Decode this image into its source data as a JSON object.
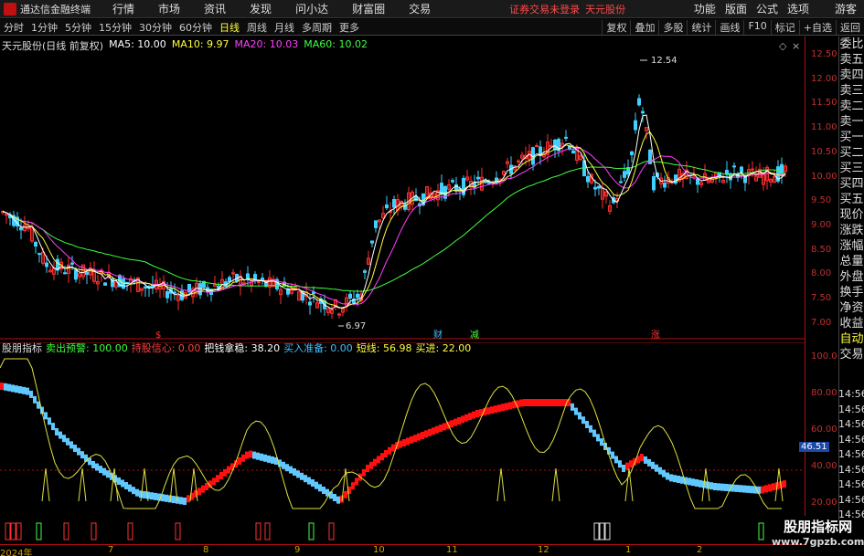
{
  "titlebar": {
    "app_name": "通达信金融终端",
    "menus": [
      "行情",
      "市场",
      "资讯",
      "发现",
      "问小达",
      "财富圈",
      "交易"
    ],
    "warning": "证券交易未登录",
    "stock_name": "天元股份",
    "right_menus": [
      "功能",
      "版面",
      "公式",
      "选项"
    ],
    "guest": "游客"
  },
  "toolbar": {
    "timeframes": [
      "分时",
      "1分钟",
      "5分钟",
      "15分钟",
      "30分钟",
      "60分钟",
      "日线",
      "周线",
      "月线",
      "多周期",
      "更多"
    ],
    "active": "日线",
    "tools": [
      "复权",
      "叠加",
      "多股",
      "统计",
      "画线",
      "F10",
      "标记",
      "+自选",
      "返回"
    ]
  },
  "main_chart": {
    "title": "天元股份(日线 前复权)",
    "ma5": "MA5: 10.00",
    "ma10": "MA10: 9.97",
    "ma20": "MA20: 10.03",
    "ma60": "MA60: 10.02",
    "high_label": "12.54",
    "low_label": "6.97",
    "markers": [
      "$",
      "财",
      "减",
      "涨"
    ],
    "colors": {
      "up": "#ff3030",
      "down": "#40d0ff",
      "ma5": "#ffffff",
      "ma10": "#ffff40",
      "ma20": "#ff40ff",
      "ma60": "#40ff40",
      "axis": "#c03030"
    }
  },
  "price_axis": [
    "12.50",
    "12.00",
    "11.50",
    "11.00",
    "10.50",
    "10.00",
    "9.50",
    "9.00",
    "8.50",
    "8.00",
    "7.50",
    "7.00"
  ],
  "indicator": {
    "name": "股朋指标",
    "sell_warn": "卖出预警: 100.00",
    "hold_conf": "持股信心: 0.00",
    "grip": "把钱拿稳: 38.20",
    "ready": "买入准备: 0.00",
    "short": "短线: 56.98",
    "buy": "买进: 22.00",
    "current_value": "46.51"
  },
  "indicator_axis": [
    "100.0",
    "80.00",
    "60.00",
    "40.00",
    "20.00"
  ],
  "side_panel": [
    "委比",
    "卖五",
    "卖四",
    "卖三",
    "卖二",
    "卖一",
    "买一",
    "买二",
    "买三",
    "买四",
    "买五",
    "现价",
    "涨跌",
    "涨幅",
    "总量",
    "外盘",
    "换手",
    "净资",
    "收益"
  ],
  "side_auto": [
    "自动",
    "交易"
  ],
  "side_times": [
    "14:56",
    "14:56",
    "14:56",
    "14:56",
    "14:56",
    "14:56",
    "14:56",
    "14:56",
    "14:56"
  ],
  "date_axis": [
    "2024年",
    "7",
    "8",
    "9",
    "10",
    "11",
    "12",
    "1",
    "2"
  ],
  "watermark": {
    "line1": "股朋指标网",
    "line2": "www.7gpzb.com"
  }
}
